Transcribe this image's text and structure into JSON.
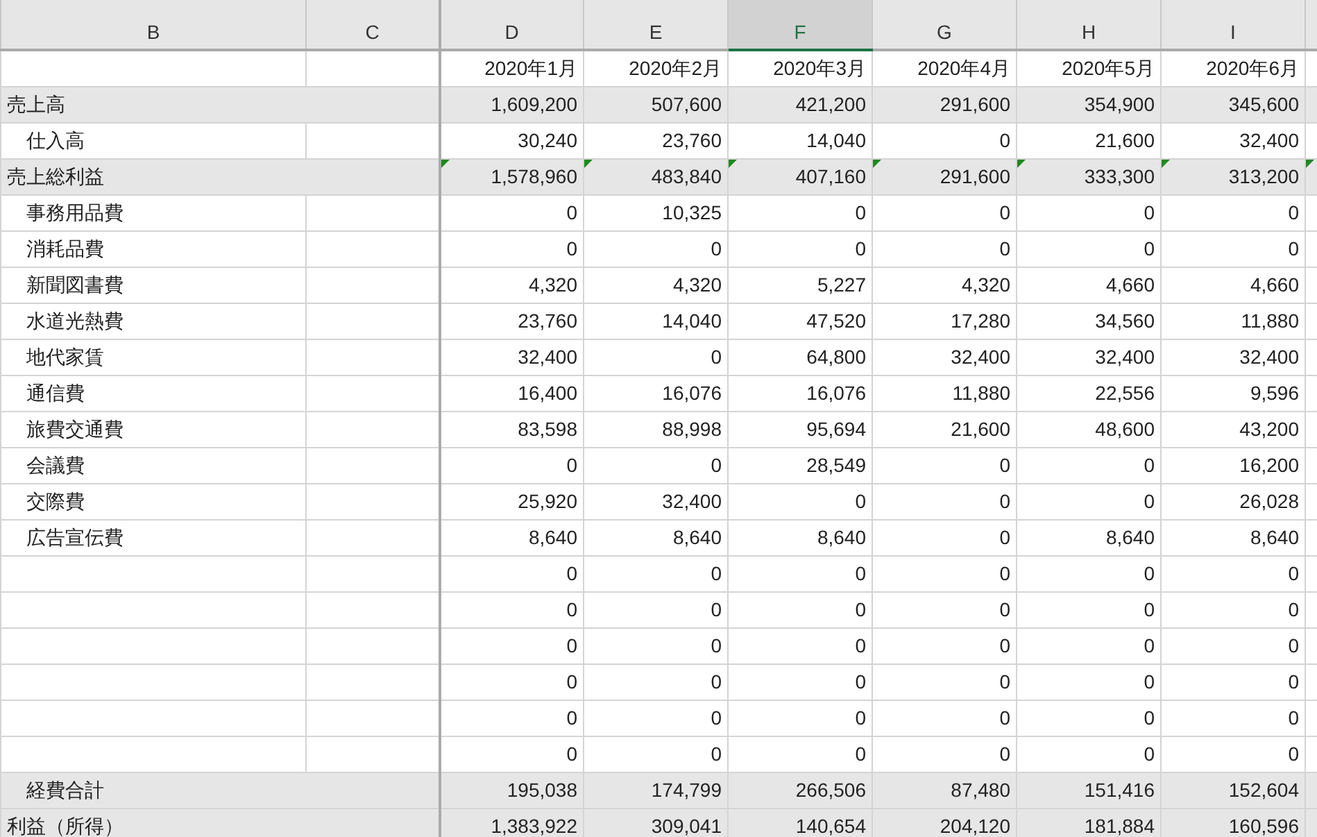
{
  "columns": [
    {
      "label": "B",
      "selected": false
    },
    {
      "label": "C",
      "selected": false
    },
    {
      "label": "D",
      "selected": false
    },
    {
      "label": "E",
      "selected": false
    },
    {
      "label": "F",
      "selected": true
    },
    {
      "label": "G",
      "selected": false
    },
    {
      "label": "H",
      "selected": false
    },
    {
      "label": "I",
      "selected": false
    }
  ],
  "months": [
    "2020年1月",
    "2020年2月",
    "2020年3月",
    "2020年4月",
    "2020年5月",
    "2020年6月"
  ],
  "rows": [
    {
      "kind": "total",
      "indented": false,
      "label": "売上高",
      "values": [
        "1,609,200",
        "507,600",
        "421,200",
        "291,600",
        "354,900",
        "345,600"
      ]
    },
    {
      "kind": "item",
      "indented": true,
      "label": "仕入高",
      "values": [
        "30,240",
        "23,760",
        "14,040",
        "0",
        "21,600",
        "32,400"
      ]
    },
    {
      "kind": "total",
      "indented": false,
      "label": "売上総利益",
      "values": [
        "1,578,960",
        "483,840",
        "407,160",
        "291,600",
        "333,300",
        "313,200"
      ],
      "flags": [
        true,
        true,
        true,
        true,
        true,
        true,
        true
      ]
    },
    {
      "kind": "item",
      "indented": true,
      "label": "事務用品費",
      "values": [
        "0",
        "10,325",
        "0",
        "0",
        "0",
        "0"
      ]
    },
    {
      "kind": "item",
      "indented": true,
      "label": "消耗品費",
      "values": [
        "0",
        "0",
        "0",
        "0",
        "0",
        "0"
      ]
    },
    {
      "kind": "item",
      "indented": true,
      "label": "新聞図書費",
      "values": [
        "4,320",
        "4,320",
        "5,227",
        "4,320",
        "4,660",
        "4,660"
      ]
    },
    {
      "kind": "item",
      "indented": true,
      "label": "水道光熱費",
      "values": [
        "23,760",
        "14,040",
        "47,520",
        "17,280",
        "34,560",
        "11,880"
      ]
    },
    {
      "kind": "item",
      "indented": true,
      "label": "地代家賃",
      "values": [
        "32,400",
        "0",
        "64,800",
        "32,400",
        "32,400",
        "32,400"
      ]
    },
    {
      "kind": "item",
      "indented": true,
      "label": "通信費",
      "values": [
        "16,400",
        "16,076",
        "16,076",
        "11,880",
        "22,556",
        "9,596"
      ]
    },
    {
      "kind": "item",
      "indented": true,
      "label": "旅費交通費",
      "values": [
        "83,598",
        "88,998",
        "95,694",
        "21,600",
        "48,600",
        "43,200"
      ]
    },
    {
      "kind": "item",
      "indented": true,
      "label": "会議費",
      "values": [
        "0",
        "0",
        "28,549",
        "0",
        "0",
        "16,200"
      ]
    },
    {
      "kind": "item",
      "indented": true,
      "label": "交際費",
      "values": [
        "25,920",
        "32,400",
        "0",
        "0",
        "0",
        "26,028"
      ]
    },
    {
      "kind": "item",
      "indented": true,
      "label": "広告宣伝費",
      "values": [
        "8,640",
        "8,640",
        "8,640",
        "0",
        "8,640",
        "8,640"
      ]
    },
    {
      "kind": "item",
      "values": [
        "0",
        "0",
        "0",
        "0",
        "0",
        "0"
      ]
    },
    {
      "kind": "item",
      "values": [
        "0",
        "0",
        "0",
        "0",
        "0",
        "0"
      ]
    },
    {
      "kind": "item",
      "values": [
        "0",
        "0",
        "0",
        "0",
        "0",
        "0"
      ]
    },
    {
      "kind": "item",
      "values": [
        "0",
        "0",
        "0",
        "0",
        "0",
        "0"
      ]
    },
    {
      "kind": "item",
      "values": [
        "0",
        "0",
        "0",
        "0",
        "0",
        "0"
      ]
    },
    {
      "kind": "item",
      "values": [
        "0",
        "0",
        "0",
        "0",
        "0",
        "0"
      ]
    },
    {
      "kind": "total",
      "indented": true,
      "label": "経費合計",
      "values": [
        "195,038",
        "174,799",
        "266,506",
        "87,480",
        "151,416",
        "152,604"
      ]
    },
    {
      "kind": "total",
      "indented": false,
      "label": "利益（所得）",
      "values": [
        "1,383,922",
        "309,041",
        "140,654",
        "204,120",
        "181,884",
        "160,596"
      ]
    }
  ]
}
